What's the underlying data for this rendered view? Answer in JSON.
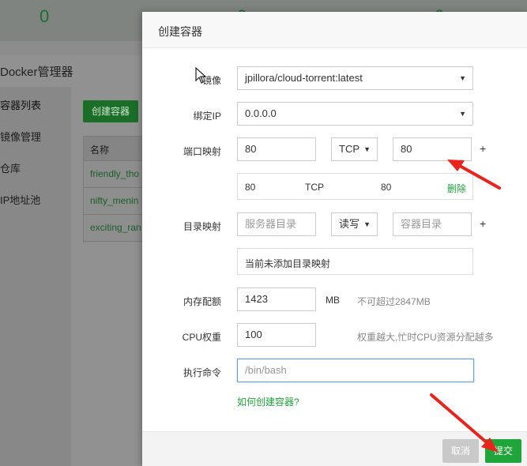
{
  "background": {
    "stats": [
      "0",
      "0",
      "0"
    ],
    "panel_title": "Docker管理器",
    "sidebar": [
      "容器列表",
      "镜像管理",
      "仓库",
      "IP地址池"
    ],
    "create_button": "创建容器",
    "table_header": "名称",
    "table_rows": [
      "friendly_tho",
      "nifty_menin",
      "exciting_ran"
    ]
  },
  "modal": {
    "title": "创建容器",
    "image": {
      "label": "镜像",
      "value": "jpillora/cloud-torrent:latest"
    },
    "bind_ip": {
      "label": "绑定IP",
      "value": "0.0.0.0"
    },
    "port_map": {
      "label": "端口映射",
      "host_port": "80",
      "protocol": "TCP",
      "container_port": "80",
      "add": "+",
      "existing": {
        "host": "80",
        "protocol": "TCP",
        "container": "80",
        "delete": "删除"
      }
    },
    "dir_map": {
      "label": "目录映射",
      "host_placeholder": "服务器目录",
      "mode": "读写",
      "container_placeholder": "容器目录",
      "add": "+",
      "empty_text": "当前未添加目录映射"
    },
    "memory": {
      "label": "内存配额",
      "value": "1423",
      "unit": "MB",
      "hint": "不可超过2847MB"
    },
    "cpu": {
      "label": "CPU权重",
      "value": "100",
      "hint": "权重越大,忙时CPU资源分配越多"
    },
    "command": {
      "label": "执行命令",
      "placeholder": "/bin/bash"
    },
    "help_link": "如何创建容器?",
    "cancel": "取消",
    "submit": "提交"
  },
  "colors": {
    "accent": "#20a53a",
    "annotation_arrow": "#e8241c"
  }
}
